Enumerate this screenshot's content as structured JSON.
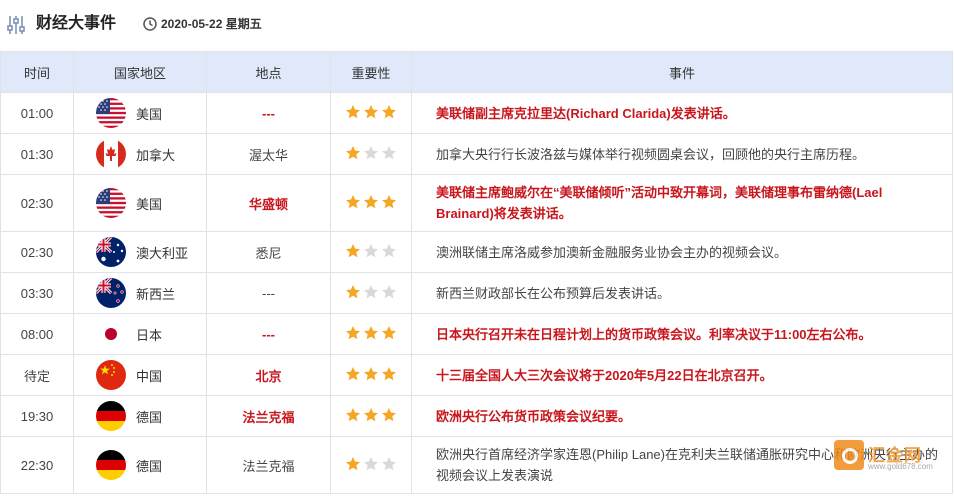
{
  "header": {
    "title": "财经大事件",
    "date": "2020-05-22 星期五"
  },
  "columns": [
    "时间",
    "国家地区",
    "地点",
    "重要性",
    "事件"
  ],
  "colors": {
    "highlight": "#c8161d",
    "header_bg": "#dfe9fa",
    "star_on": "#f5a623",
    "star_off": "#d9d9d9"
  },
  "rows": [
    {
      "time": "01:00",
      "country": "美国",
      "flag": "us",
      "place": "---",
      "stars": 3,
      "highlight": true,
      "event": "美联储副主席克拉里达(Richard Clarida)发表讲话。"
    },
    {
      "time": "01:30",
      "country": "加拿大",
      "flag": "ca",
      "place": "渥太华",
      "stars": 1,
      "highlight": false,
      "event": "加拿大央行行长波洛兹与媒体举行视频圆桌会议，回顾他的央行主席历程。"
    },
    {
      "time": "02:30",
      "country": "美国",
      "flag": "us",
      "place": "华盛顿",
      "stars": 3,
      "highlight": true,
      "event": "美联储主席鲍威尔在“美联储倾听”活动中致开幕词，美联储理事布雷纳德(Lael Brainard)将发表讲话。"
    },
    {
      "time": "02:30",
      "country": "澳大利亚",
      "flag": "au",
      "place": "悉尼",
      "stars": 1,
      "highlight": false,
      "event": "澳洲联储主席洛威参加澳新金融服务业协会主办的视频会议。"
    },
    {
      "time": "03:30",
      "country": "新西兰",
      "flag": "nz",
      "place": "---",
      "stars": 1,
      "highlight": false,
      "event": "新西兰财政部长在公布预算后发表讲话。"
    },
    {
      "time": "08:00",
      "country": "日本",
      "flag": "jp",
      "place": "---",
      "stars": 3,
      "highlight": true,
      "event": "日本央行召开未在日程计划上的货币政策会议。利率决议于11:00左右公布。"
    },
    {
      "time": "待定",
      "country": "中国",
      "flag": "cn",
      "place": "北京",
      "stars": 3,
      "highlight": true,
      "event": "十三届全国人大三次会议将于2020年5月22日在北京召开。"
    },
    {
      "time": "19:30",
      "country": "德国",
      "flag": "de",
      "place": "法兰克福",
      "stars": 3,
      "highlight": true,
      "event": "欧洲央行公布货币政策会议纪要。"
    },
    {
      "time": "22:30",
      "country": "德国",
      "flag": "de",
      "place": "法兰克福",
      "stars": 1,
      "highlight": false,
      "event": "欧洲央行首席经济学家连恩(Philip Lane)在克利夫兰联储通胀研究中心和欧洲央行主办的视频会议上发表演说"
    }
  ],
  "watermark": {
    "text": "汇金网",
    "sub": "www.gold678.com"
  }
}
